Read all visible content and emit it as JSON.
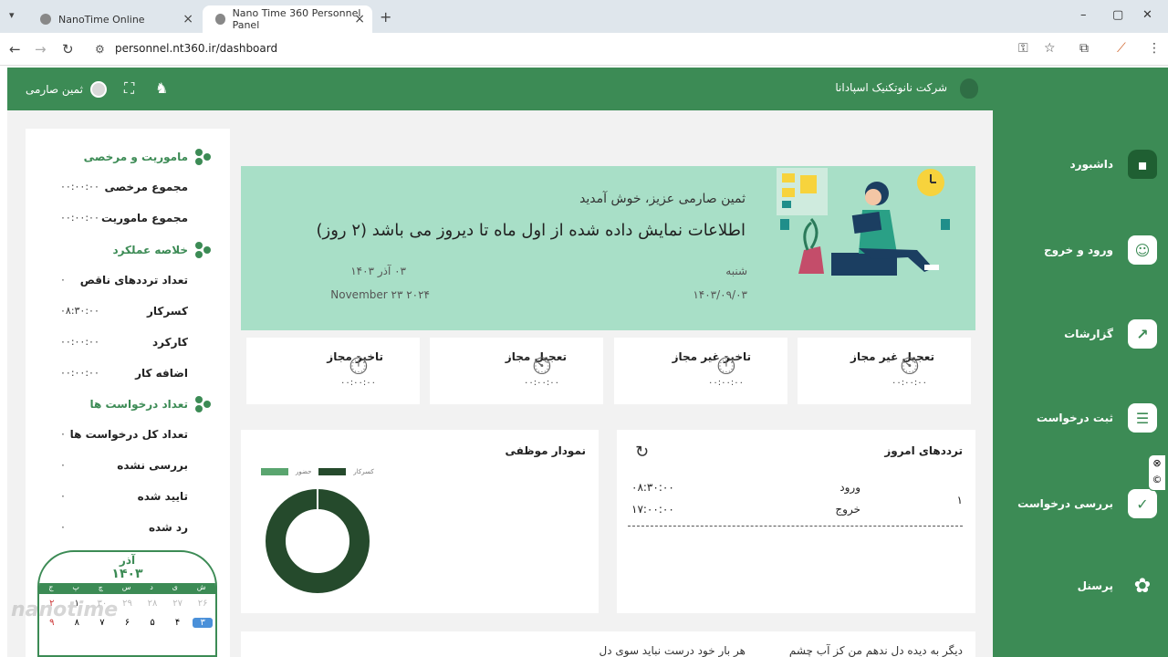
{
  "browser": {
    "tabs": [
      {
        "title": "NanoTime Online"
      },
      {
        "title": "Nano Time 360 Personnel Panel"
      }
    ],
    "url": "personnel.nt360.ir/dashboard"
  },
  "header": {
    "company": "شرکت نانوتکنیک اسپادانا",
    "user_name": "ثمین صارمی"
  },
  "sidebar": {
    "items": [
      {
        "label": "داشبورد",
        "icon": "home-icon"
      },
      {
        "label": "ورود و خروج",
        "icon": "user-check-icon"
      },
      {
        "label": "گزارشات",
        "icon": "chart-icon"
      },
      {
        "label": "ثبت درخواست",
        "icon": "clipboard-icon"
      },
      {
        "label": "بررسی درخواست",
        "icon": "clipboard-check-icon"
      },
      {
        "label": "پرسنل",
        "icon": "people-icon"
      }
    ]
  },
  "left_panel": {
    "mission": {
      "title": "ماموریت و مرخصی",
      "rows": [
        {
          "label": "مجموع مرخصی",
          "value": "۰۰:۰۰:۰۰"
        },
        {
          "label": "مجموع ماموریت",
          "value": "۰۰:۰۰:۰۰"
        }
      ]
    },
    "performance": {
      "title": "خلاصه عملکرد",
      "rows": [
        {
          "label": "تعداد ترددهای ناقص",
          "value": "۰"
        },
        {
          "label": "کسرکار",
          "value": "۰۸:۳۰:۰۰"
        },
        {
          "label": "کارکرد",
          "value": "۰۰:۰۰:۰۰"
        },
        {
          "label": "اضافه کار",
          "value": "۰۰:۰۰:۰۰"
        }
      ]
    },
    "requests": {
      "title": "تعداد درخواست ها",
      "rows": [
        {
          "label": "تعداد کل درخواست ها",
          "value": "۰"
        },
        {
          "label": "بررسی نشده",
          "value": "۰"
        },
        {
          "label": "تایید شده",
          "value": "۰"
        },
        {
          "label": "رد شده",
          "value": "۰"
        }
      ]
    }
  },
  "calendar": {
    "month": "آذر",
    "year": "۱۴۰۳",
    "weekdays": [
      "ج",
      "پ",
      "چ",
      "س",
      "د",
      "ی",
      "ش"
    ],
    "row_prev": [
      "۲",
      "۱",
      "۳۰",
      "۲۹",
      "۲۸",
      "۲۷",
      "۲۶"
    ],
    "row_current": [
      "۹",
      "۸",
      "۷",
      "۶",
      "۵",
      "۴",
      "۳"
    ]
  },
  "banner": {
    "greeting": "ثمین صارمی عزیز، خوش آمدید",
    "info": "اطلاعات نمایش داده شده از اول ماه تا دیروز می باشد (۲ روز)",
    "weekday": "شنبه",
    "date_persian_numeric": "۱۴۰۳/۰۹/۰۳",
    "date_persian_text": "۰۳ آذر ۱۴۰۳",
    "date_gregorian": "November ۲۳ ۲۰۲۴"
  },
  "cards": [
    {
      "title": "تاخیر مجاز",
      "value": "۰۰:۰۰:۰۰"
    },
    {
      "title": "تعجیل مجاز",
      "value": "۰۰:۰۰:۰۰"
    },
    {
      "title": "تاخیر غیر مجاز",
      "value": "۰۰:۰۰:۰۰"
    },
    {
      "title": "تعجیل غیر مجاز",
      "value": "۰۰:۰۰:۰۰"
    }
  ],
  "attendance_chart": {
    "title": "نمودار موظفی",
    "legend": [
      "حضور",
      "کسرکار"
    ]
  },
  "chart_data": {
    "type": "pie",
    "title": "نمودار موظفی",
    "categories": [
      "کسرکار",
      "حضور"
    ],
    "values": [
      100,
      0
    ],
    "colors": [
      "#254a2c",
      "#5aa56f"
    ]
  },
  "today_traffic": {
    "title": "ترددهای امروز",
    "index": "۱",
    "entry_label": "ورود",
    "entry_time": "۰۸:۳۰:۰۰",
    "exit_label": "خروج",
    "exit_time": "۱۷:۰۰:۰۰"
  },
  "bottom": {
    "text_right": "دیگر به دیده دل ندهم من کز آب چشم",
    "text_left": "هر بار خود درست نباید سوی دل"
  },
  "watermark": "nanotime"
}
